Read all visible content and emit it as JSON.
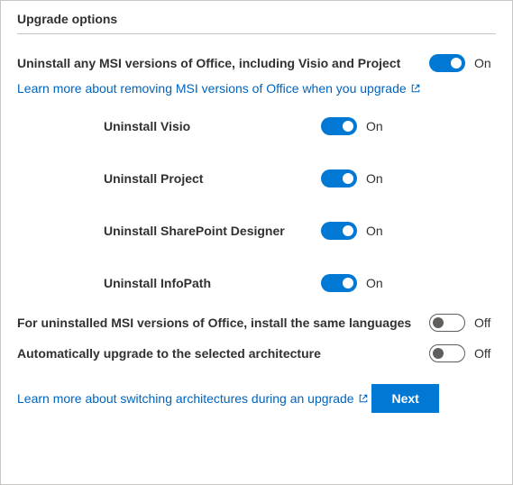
{
  "title": "Upgrade options",
  "mainOption": {
    "label": "Uninstall any MSI versions of Office, including Visio and Project",
    "state": "On",
    "enabled": true
  },
  "learnMoreMsi": "Learn more about removing MSI versions of Office when you upgrade",
  "subOptions": [
    {
      "label": "Uninstall Visio",
      "state": "On",
      "enabled": true
    },
    {
      "label": "Uninstall Project",
      "state": "On",
      "enabled": true
    },
    {
      "label": "Uninstall SharePoint Designer",
      "state": "On",
      "enabled": true
    },
    {
      "label": "Uninstall InfoPath",
      "state": "On",
      "enabled": true
    }
  ],
  "sameLanguages": {
    "label": "For uninstalled MSI versions of Office, install the same languages",
    "state": "Off",
    "enabled": false
  },
  "autoUpgrade": {
    "label": "Automatically upgrade to the selected architecture",
    "state": "Off",
    "enabled": false
  },
  "learnMoreArch": "Learn more about switching architectures during an upgrade",
  "nextButton": "Next"
}
